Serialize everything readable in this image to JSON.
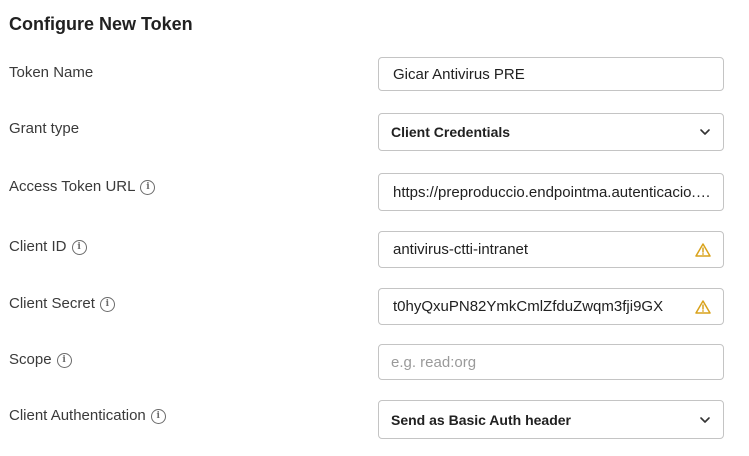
{
  "title": "Configure New Token",
  "fields": {
    "token_name": {
      "label": "Token Name",
      "value": "Gicar Antivirus PRE"
    },
    "grant_type": {
      "label": "Grant type",
      "value": "Client Credentials"
    },
    "access_token_url": {
      "label": "Access Token URL",
      "value": "https://preproduccio.endpointma.autenticacio.intranet"
    },
    "client_id": {
      "label": "Client ID",
      "value": "antivirus-ctti-intranet"
    },
    "client_secret": {
      "label": "Client Secret",
      "value": "t0hyQxuPN82YmkCmlZfduZwqm3fji9GX"
    },
    "scope": {
      "label": "Scope",
      "value": "",
      "placeholder": "e.g. read:org"
    },
    "client_auth": {
      "label": "Client Authentication",
      "value": "Send as Basic Auth header"
    }
  },
  "icons": {
    "info": "info-icon",
    "warning": "warning-icon",
    "chevron": "chevron-down-icon"
  },
  "colors": {
    "warning": "#d9a21b",
    "border": "#c4c4c4"
  }
}
